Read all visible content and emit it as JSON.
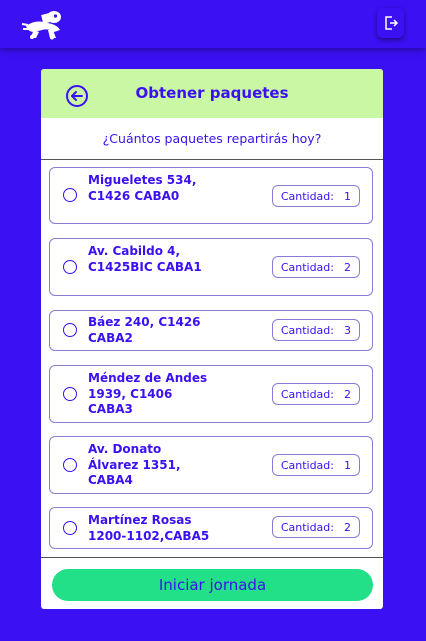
{
  "app": {
    "logo_icon": "delivery-courier-logo",
    "logout_icon": "logout-icon"
  },
  "header": {
    "title": "Obtener paquetes",
    "back_icon": "back-arrow-circle-icon"
  },
  "question": "¿Cuántos paquetes repartirás hoy?",
  "quantity_label": "Cantidad:",
  "packages": [
    {
      "address": "Migueletes 534, C1426 CABA0",
      "quantity": "1",
      "selected": false
    },
    {
      "address": "Av. Cabildo 4, C1425BIC CABA1",
      "quantity": "2",
      "selected": false
    },
    {
      "address": "Báez 240, C1426 CABA2",
      "quantity": "3",
      "selected": false
    },
    {
      "address": "Méndez de Andes 1939, C1406 CABA3",
      "quantity": "2",
      "selected": false
    },
    {
      "address": "Av. Donato Álvarez 1351, CABA4",
      "quantity": "1",
      "selected": false
    },
    {
      "address": "Martínez Rosas 1200-1102,CABA5",
      "quantity": "2",
      "selected": false
    }
  ],
  "start_button": "Iniciar jornada",
  "colors": {
    "background": "#3b10f2",
    "header": "#c9f7a3",
    "primary_text": "#3b10f2",
    "button": "#21e088"
  }
}
